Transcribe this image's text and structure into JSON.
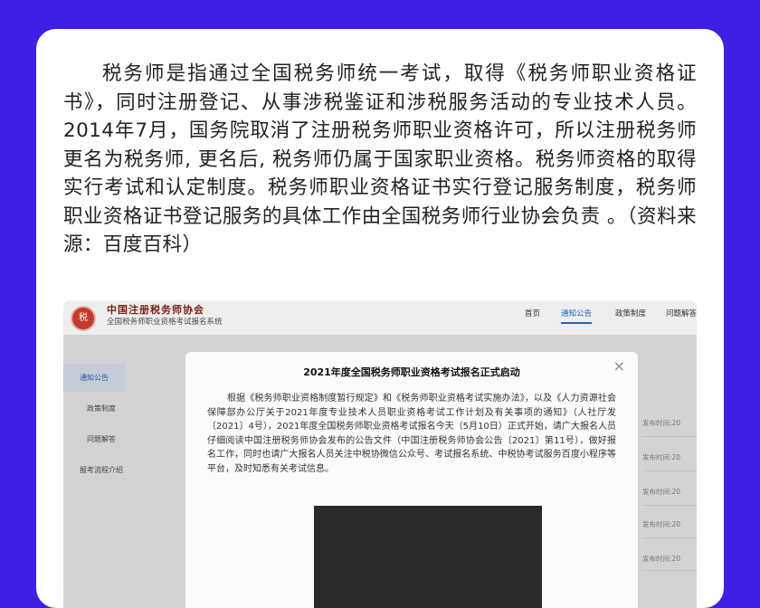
{
  "intro": {
    "text": "税务师是指通过全国税务师统一考试，取得《税务师职业资格证书》，同时注册登记、从事涉税鉴证和涉税服务活动的专业技术人员。2014年7月，国务院取消了注册税务师职业资格许可，所以注册税务师更名为税务师, 更名后, 税务师仍属于国家职业资格。税务师资格的取得实行考试和认定制度。税务师职业资格证书实行登记服务制度，税务师职业资格证书登记服务的具体工作由全国税务师行业协会负责 。（资料来源：百度百科）"
  },
  "site": {
    "logo_calligraphy": "中国注册税务师协会",
    "subtitle": "全国税务师职业资格考试报名系统",
    "nav": [
      "首页",
      "通知公告",
      "政策制度",
      "问题解答"
    ],
    "sidebar": [
      "通知公告",
      "政策制度",
      "问题解答",
      "报考流程介绍"
    ],
    "publish_label": "发布时间:20"
  },
  "modal": {
    "title": "2021年度全国税务师职业资格考试报名正式启动",
    "close": "×",
    "body": "根据《税务师职业资格制度暂行规定》和《税务师职业资格考试实施办法》，以及《人力资源社会保障部办公厅关于2021年度专业技术人员职业资格考试工作计划及有关事项的通知》（人社厅发〔2021〕4号），2021年度全国税务师职业资格考试报名今天（5月10日）正式开始，请广大报名人员仔细阅读中国注册税务师协会发布的公告文件（中国注册税务师协会公告〔2021〕第11号），做好报名工作，同时也请广大报名人员关注中税协微信公众号、考试报名系统、中税协考试服务百度小程序等平台，及时知悉有关考试信息。"
  },
  "colors": {
    "background": "#3f1ee6",
    "card": "#ffffff",
    "active_nav": "#2a63b8"
  }
}
